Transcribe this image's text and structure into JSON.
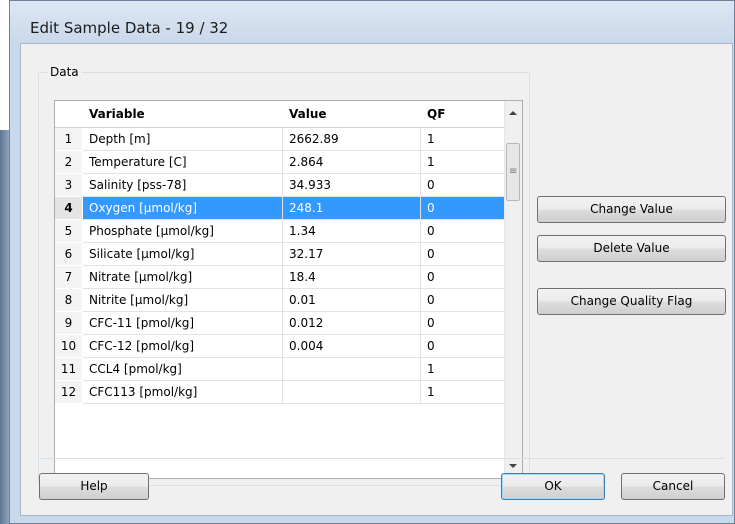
{
  "window": {
    "title": "Edit Sample Data - 19 / 32"
  },
  "group": {
    "label": "Data"
  },
  "table": {
    "columns": [
      "Variable",
      "Value",
      "QF"
    ],
    "selected_row": 4,
    "rows": [
      {
        "n": "1",
        "variable": "Depth [m]",
        "value": "2662.89",
        "qf": "1"
      },
      {
        "n": "2",
        "variable": "Temperature [C]",
        "value": "2.864",
        "qf": "1"
      },
      {
        "n": "3",
        "variable": "Salinity [pss-78]",
        "value": "34.933",
        "qf": "0"
      },
      {
        "n": "4",
        "variable": "Oxygen [µmol/kg]",
        "value": "248.1",
        "qf": "0"
      },
      {
        "n": "5",
        "variable": "Phosphate [µmol/kg]",
        "value": "1.34",
        "qf": "0"
      },
      {
        "n": "6",
        "variable": "Silicate [µmol/kg]",
        "value": "32.17",
        "qf": "0"
      },
      {
        "n": "7",
        "variable": "Nitrate [µmol/kg]",
        "value": "18.4",
        "qf": "0"
      },
      {
        "n": "8",
        "variable": "Nitrite [µmol/kg]",
        "value": "0.01",
        "qf": "0"
      },
      {
        "n": "9",
        "variable": "CFC-11 [pmol/kg]",
        "value": "0.012",
        "qf": "0"
      },
      {
        "n": "10",
        "variable": "CFC-12 [pmol/kg]",
        "value": "0.004",
        "qf": "0"
      },
      {
        "n": "11",
        "variable": "CCL4 [pmol/kg]",
        "value": "",
        "qf": "1"
      },
      {
        "n": "12",
        "variable": "CFC113 [pmol/kg]",
        "value": "",
        "qf": "1"
      }
    ]
  },
  "buttons": {
    "change_value": "Change Value",
    "delete_value": "Delete Value",
    "change_quality_flag": "Change Quality Flag",
    "help": "Help",
    "ok": "OK",
    "cancel": "Cancel"
  },
  "colors": {
    "selection": "#3399ff",
    "title_bar": "#c9d8ea"
  }
}
